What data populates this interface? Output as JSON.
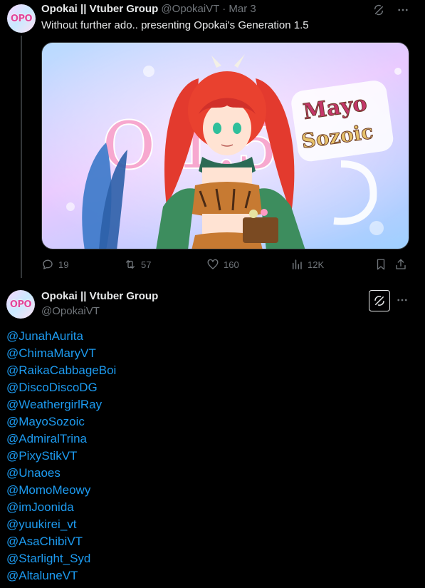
{
  "tweet1": {
    "avatar_text": "OPO",
    "display_name": "Opokai || Vtuber Group",
    "handle": "@OpokaiVT",
    "separator": "·",
    "date": "Mar 3",
    "text": "Without further ado.. presenting Opokai's Generation 1.5",
    "media": {
      "big_letters": "O 1.5",
      "sign_line1": "Mayo",
      "sign_line2": "Sozoic"
    },
    "actions": {
      "replies": "19",
      "reposts": "57",
      "likes": "160",
      "views": "12K"
    }
  },
  "tweet2": {
    "avatar_text": "OPO",
    "display_name": "Opokai || Vtuber Group",
    "handle": "@OpokaiVT",
    "mentions": [
      "@JunahAurita",
      "@ChimaMaryVT",
      "@RaikaCabbageBoi",
      "@DiscoDiscoDG",
      "@WeathergirlRay",
      "@MayoSozoic",
      "@AdmiralTrina",
      "@PixyStikVT",
      "@Unaoes",
      "@MomoMeowy",
      "@imJoonida",
      "@yuukirei_vt",
      "@AsaChibiVT",
      "@Starlight_Syd",
      "@AltaluneVT"
    ]
  },
  "colors": {
    "background": "#000000",
    "text": "#e7e9ea",
    "muted": "#71767b",
    "link": "#1d9bf0",
    "divider": "#2f3336"
  },
  "icons": [
    "grok-icon",
    "more-icon",
    "reply-icon",
    "repost-icon",
    "like-icon",
    "views-icon",
    "bookmark-icon",
    "share-icon"
  ]
}
